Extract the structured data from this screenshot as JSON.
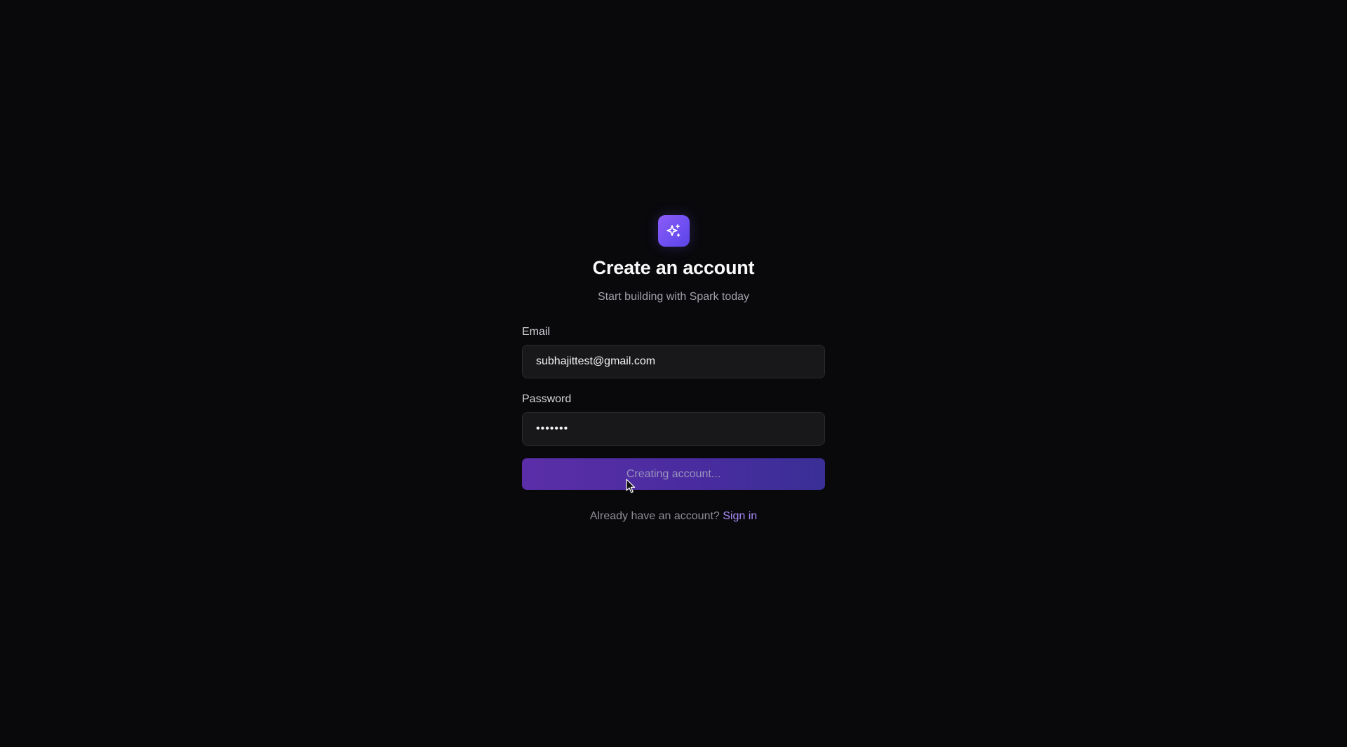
{
  "brand": {
    "logo_icon": "sparkles-icon",
    "accent_color": "#7c5cf6"
  },
  "header": {
    "title": "Create an account",
    "subtitle": "Start building with Spark today"
  },
  "form": {
    "email": {
      "label": "Email",
      "value": "subhajittest@gmail.com"
    },
    "password": {
      "label": "Password",
      "value": "•••••••"
    },
    "submit_label": "Creating account..."
  },
  "footer": {
    "prompt": "Already have an account?",
    "link_label": "Sign in"
  }
}
